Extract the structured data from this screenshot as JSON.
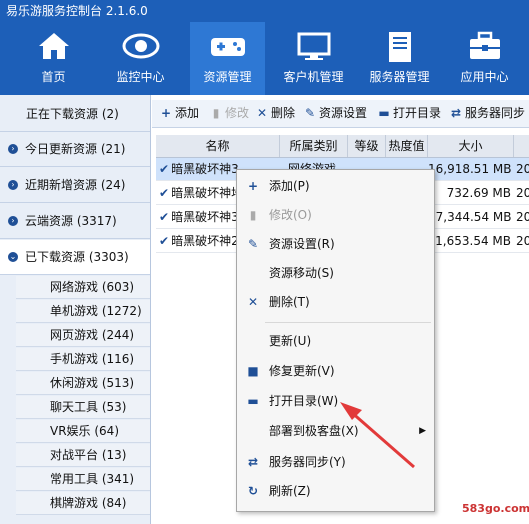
{
  "app": {
    "title": "易乐游服务控制台 2.1.6.0"
  },
  "nav": [
    {
      "label": "首页",
      "icon": "home-icon"
    },
    {
      "label": "监控中心",
      "icon": "eye-icon"
    },
    {
      "label": "资源管理",
      "icon": "gamepad-icon",
      "active": true
    },
    {
      "label": "客户机管理",
      "icon": "monitor-icon"
    },
    {
      "label": "服务器管理",
      "icon": "server-icon"
    },
    {
      "label": "应用中心",
      "icon": "toolbox-icon"
    }
  ],
  "sidebar": {
    "items": [
      {
        "label": "正在下载资源 (2)"
      },
      {
        "label": "今日更新资源 (21)"
      },
      {
        "label": "近期新增资源 (24)"
      },
      {
        "label": "云端资源 (3317)"
      },
      {
        "label": "已下载资源 (3303)"
      }
    ],
    "subitems": [
      {
        "label": "网络游戏 (603)"
      },
      {
        "label": "单机游戏 (1272)"
      },
      {
        "label": "网页游戏 (244)"
      },
      {
        "label": "手机游戏 (116)"
      },
      {
        "label": "休闲游戏 (513)"
      },
      {
        "label": "聊天工具 (53)"
      },
      {
        "label": "VR娱乐 (64)"
      },
      {
        "label": "对战平台 (13)"
      },
      {
        "label": "常用工具 (341)"
      },
      {
        "label": "棋牌游戏 (84)"
      }
    ]
  },
  "toolbar": {
    "add": "添加",
    "edit": "修改",
    "delete": "删除",
    "settings": "资源设置",
    "open_dir": "打开目录",
    "sync": "服务器同步"
  },
  "table": {
    "headers": [
      "名称",
      "所属类别",
      "等级",
      "热度值",
      "大小"
    ],
    "rows": [
      {
        "name": "暗黑破坏神3",
        "category": "网络游戏",
        "level": "",
        "heat": "",
        "size": "16,918.51 MB",
        "date": "20"
      },
      {
        "name": "暗黑破坏神地",
        "category": "",
        "level": "",
        "heat": "",
        "size": "732.69 MB",
        "date": "20"
      },
      {
        "name": "暗黑破坏神3",
        "category": "",
        "level": "",
        "heat": "",
        "size": "17,344.54 MB",
        "date": "20"
      },
      {
        "name": "暗黑破坏神2",
        "category": "",
        "level": "",
        "heat": "",
        "size": "1,653.54 MB",
        "date": "20"
      }
    ]
  },
  "context_menu": {
    "items": [
      {
        "label": "添加(P)",
        "icon": "plus-icon"
      },
      {
        "label": "修改(O)",
        "icon": "edit-icon",
        "disabled": true
      },
      {
        "label": "资源设置(R)",
        "icon": "wrench-icon"
      },
      {
        "label": "资源移动(S)",
        "icon": ""
      },
      {
        "label": "删除(T)",
        "icon": "x-icon"
      },
      {
        "label": "更新(U)",
        "icon": ""
      },
      {
        "label": "修复更新(V)",
        "icon": "repair-icon"
      },
      {
        "label": "打开目录(W)",
        "icon": "folder-icon"
      },
      {
        "label": "部署到极客盘(X)",
        "icon": "",
        "submenu": true
      },
      {
        "label": "服务器同步(Y)",
        "icon": "sync-icon"
      },
      {
        "label": "刷新(Z)",
        "icon": "refresh-icon"
      }
    ]
  },
  "watermark": "583go.com",
  "colors": {
    "header_bg": "#1d5fb8",
    "nav_active": "#2e78d4",
    "selection": "#cfe2fb",
    "arrow": "#e23a3a"
  }
}
